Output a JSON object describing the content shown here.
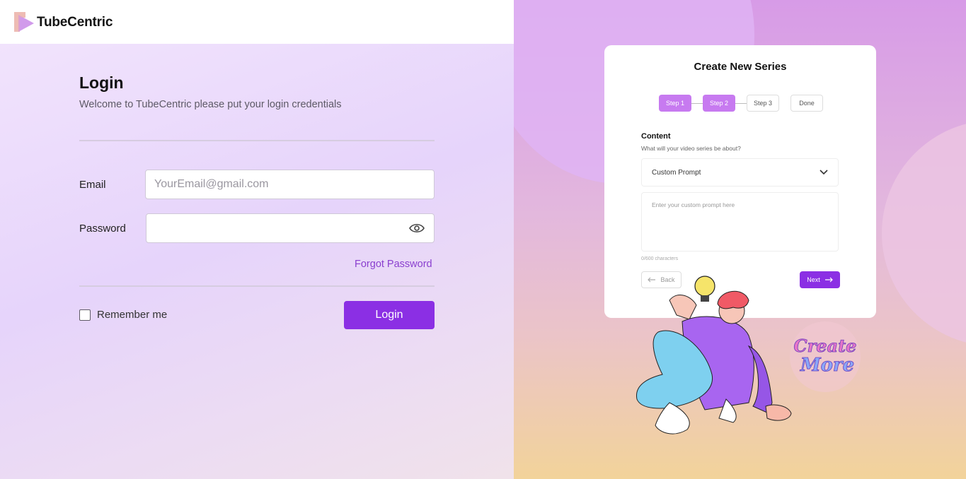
{
  "app": {
    "brand": "TubeCentric"
  },
  "login": {
    "title": "Login",
    "subtitle": "Welcome to TubeCentric please put your login credentials",
    "email_label": "Email",
    "email_placeholder": "YourEmail@gmail.com",
    "email_value": "",
    "password_label": "Password",
    "password_value": "",
    "forgot_label": "Forgot Password",
    "remember_label": "Remember me",
    "remember_checked": false,
    "login_button": "Login"
  },
  "preview": {
    "card_title": "Create New Series",
    "steps": [
      "Step 1",
      "Step 2",
      "Step 3",
      "Done"
    ],
    "content_label": "Content",
    "content_sub": "What will your video series be about?",
    "select_value": "Custom Prompt",
    "prompt_placeholder": "Enter your custom prompt here",
    "char_count": "0/600 characters",
    "back_label": "Back",
    "next_label": "Next",
    "sticker_text": "Create More"
  },
  "colors": {
    "accent": "#8b2fe4",
    "step_active": "#c77af0",
    "link": "#8a3fcf"
  }
}
